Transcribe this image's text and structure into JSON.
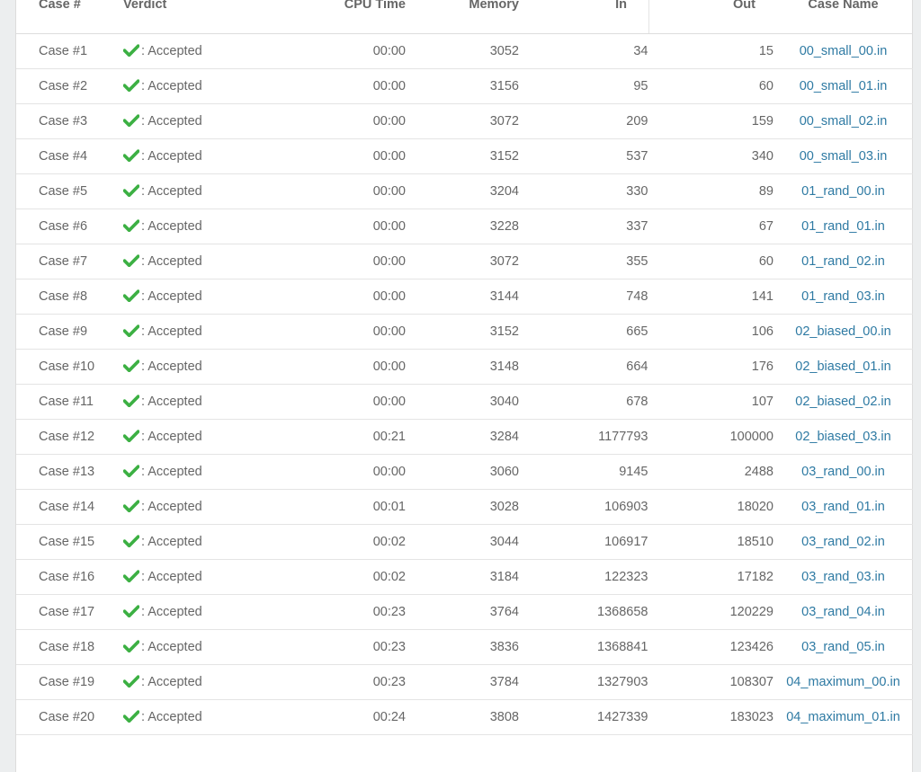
{
  "colors": {
    "accent_link": "#2e7aa3",
    "check_green": "#3cb043",
    "text": "#666666",
    "background": "#eceeef"
  },
  "header": {
    "case": "Case #",
    "verdict": "Verdict",
    "cpu": "CPU Time",
    "memory": "Memory",
    "in": "In",
    "out": "Out",
    "name": "Case Name"
  },
  "verdict_icon": "check-icon",
  "rows": [
    {
      "case": "Case #1",
      "verdict": ": Accepted",
      "cpu": "00:00",
      "memory": "3052",
      "in": "34",
      "out": "15",
      "name": "00_small_00.in"
    },
    {
      "case": "Case #2",
      "verdict": ": Accepted",
      "cpu": "00:00",
      "memory": "3156",
      "in": "95",
      "out": "60",
      "name": "00_small_01.in"
    },
    {
      "case": "Case #3",
      "verdict": ": Accepted",
      "cpu": "00:00",
      "memory": "3072",
      "in": "209",
      "out": "159",
      "name": "00_small_02.in"
    },
    {
      "case": "Case #4",
      "verdict": ": Accepted",
      "cpu": "00:00",
      "memory": "3152",
      "in": "537",
      "out": "340",
      "name": "00_small_03.in"
    },
    {
      "case": "Case #5",
      "verdict": ": Accepted",
      "cpu": "00:00",
      "memory": "3204",
      "in": "330",
      "out": "89",
      "name": "01_rand_00.in"
    },
    {
      "case": "Case #6",
      "verdict": ": Accepted",
      "cpu": "00:00",
      "memory": "3228",
      "in": "337",
      "out": "67",
      "name": "01_rand_01.in"
    },
    {
      "case": "Case #7",
      "verdict": ": Accepted",
      "cpu": "00:00",
      "memory": "3072",
      "in": "355",
      "out": "60",
      "name": "01_rand_02.in"
    },
    {
      "case": "Case #8",
      "verdict": ": Accepted",
      "cpu": "00:00",
      "memory": "3144",
      "in": "748",
      "out": "141",
      "name": "01_rand_03.in"
    },
    {
      "case": "Case #9",
      "verdict": ": Accepted",
      "cpu": "00:00",
      "memory": "3152",
      "in": "665",
      "out": "106",
      "name": "02_biased_00.in"
    },
    {
      "case": "Case #10",
      "verdict": ": Accepted",
      "cpu": "00:00",
      "memory": "3148",
      "in": "664",
      "out": "176",
      "name": "02_biased_01.in"
    },
    {
      "case": "Case #11",
      "verdict": ": Accepted",
      "cpu": "00:00",
      "memory": "3040",
      "in": "678",
      "out": "107",
      "name": "02_biased_02.in"
    },
    {
      "case": "Case #12",
      "verdict": ": Accepted",
      "cpu": "00:21",
      "memory": "3284",
      "in": "1177793",
      "out": "100000",
      "name": "02_biased_03.in"
    },
    {
      "case": "Case #13",
      "verdict": ": Accepted",
      "cpu": "00:00",
      "memory": "3060",
      "in": "9145",
      "out": "2488",
      "name": "03_rand_00.in"
    },
    {
      "case": "Case #14",
      "verdict": ": Accepted",
      "cpu": "00:01",
      "memory": "3028",
      "in": "106903",
      "out": "18020",
      "name": "03_rand_01.in"
    },
    {
      "case": "Case #15",
      "verdict": ": Accepted",
      "cpu": "00:02",
      "memory": "3044",
      "in": "106917",
      "out": "18510",
      "name": "03_rand_02.in"
    },
    {
      "case": "Case #16",
      "verdict": ": Accepted",
      "cpu": "00:02",
      "memory": "3184",
      "in": "122323",
      "out": "17182",
      "name": "03_rand_03.in"
    },
    {
      "case": "Case #17",
      "verdict": ": Accepted",
      "cpu": "00:23",
      "memory": "3764",
      "in": "1368658",
      "out": "120229",
      "name": "03_rand_04.in"
    },
    {
      "case": "Case #18",
      "verdict": ": Accepted",
      "cpu": "00:23",
      "memory": "3836",
      "in": "1368841",
      "out": "123426",
      "name": "03_rand_05.in"
    },
    {
      "case": "Case #19",
      "verdict": ": Accepted",
      "cpu": "00:23",
      "memory": "3784",
      "in": "1327903",
      "out": "108307",
      "name": "04_maximum_00.in"
    },
    {
      "case": "Case #20",
      "verdict": ": Accepted",
      "cpu": "00:24",
      "memory": "3808",
      "in": "1427339",
      "out": "183023",
      "name": "04_maximum_01.in"
    }
  ]
}
